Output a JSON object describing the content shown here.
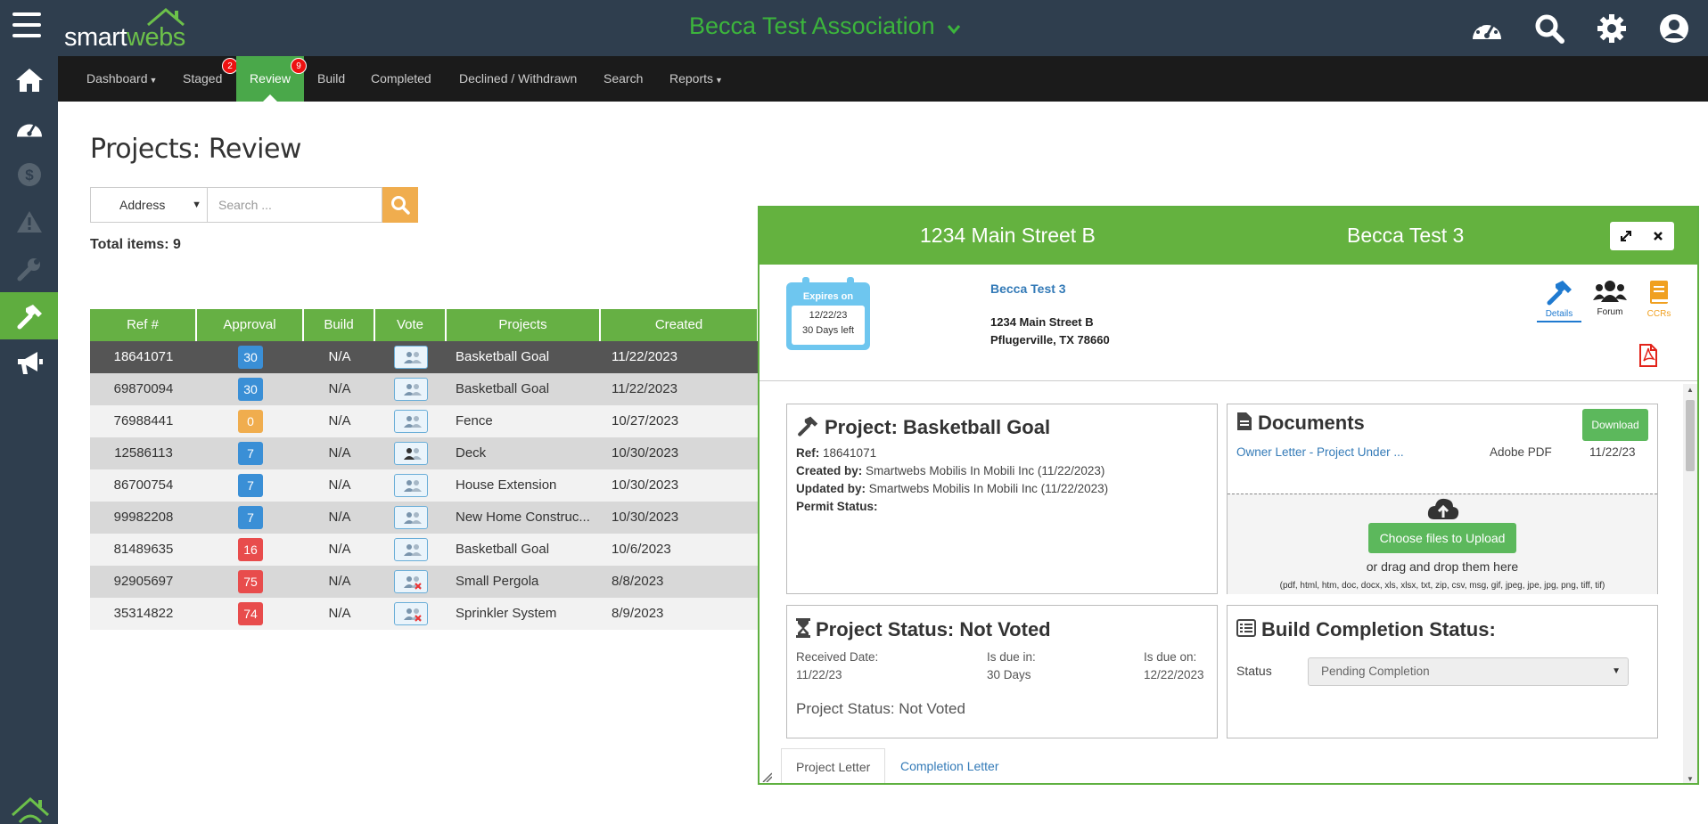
{
  "app": {
    "logo_text_white": "smart",
    "logo_text_green": "webs",
    "association": "Becca Test Association"
  },
  "top_icons": [
    "dashboard-gauge-icon",
    "search-icon",
    "gear-icon",
    "user-circle-icon"
  ],
  "sidebar": {
    "items": [
      {
        "name": "home-icon",
        "active": false
      },
      {
        "name": "dashboard-gauge-icon",
        "active": false
      },
      {
        "name": "dollar-icon",
        "active": false
      },
      {
        "name": "warning-icon",
        "active": false
      },
      {
        "name": "wrench-icon",
        "active": false
      },
      {
        "name": "hammer-icon",
        "active": true
      },
      {
        "name": "megaphone-icon",
        "active": false
      }
    ]
  },
  "nav": {
    "dashboard": "Dashboard",
    "staged": "Staged",
    "staged_count": "2",
    "review": "Review",
    "review_count": "9",
    "build": "Build",
    "completed": "Completed",
    "declined": "Declined / Withdrawn",
    "search": "Search",
    "reports": "Reports"
  },
  "page": {
    "title": "Projects: Review",
    "filter_value": "Address",
    "search_placeholder": "Search ...",
    "total_label": "Total items: 9"
  },
  "table": {
    "headers": {
      "ref": "Ref #",
      "approval": "Approval",
      "build": "Build",
      "vote": "Vote",
      "projects": "Projects",
      "created": "Created"
    },
    "rows": [
      {
        "ref": "18641071",
        "approval": "30",
        "build": "N/A",
        "project": "Basketball Goal",
        "created": "11/22/2023"
      },
      {
        "ref": "69870094",
        "approval": "30",
        "build": "N/A",
        "project": "Basketball Goal",
        "created": "11/22/2023"
      },
      {
        "ref": "76988441",
        "approval": "0",
        "build": "N/A",
        "project": "Fence",
        "created": "10/27/2023"
      },
      {
        "ref": "12586113",
        "approval": "7",
        "build": "N/A",
        "project": "Deck",
        "created": "10/30/2023"
      },
      {
        "ref": "86700754",
        "approval": "7",
        "build": "N/A",
        "project": "House Extension",
        "created": "10/30/2023"
      },
      {
        "ref": "99982208",
        "approval": "7",
        "build": "N/A",
        "project": "New Home Construc...",
        "created": "10/30/2023"
      },
      {
        "ref": "81489635",
        "approval": "16",
        "build": "N/A",
        "project": "Basketball Goal",
        "created": "10/6/2023"
      },
      {
        "ref": "92905697",
        "approval": "75",
        "build": "N/A",
        "project": "Small Pergola",
        "created": "8/8/2023"
      },
      {
        "ref": "35314822",
        "approval": "74",
        "build": "N/A",
        "project": "Sprinkler System",
        "created": "8/9/2023"
      }
    ],
    "badge_colors": {
      "blue": "#3a8fd6",
      "orange": "#f0ad4e",
      "red": "#e84c4c"
    }
  },
  "panel": {
    "address": "1234 Main Street B",
    "association": "Becca Test 3",
    "expires_label": "Expires on",
    "expires_date": "12/22/23",
    "days_left": "30 Days left",
    "owner": "Becca Test 3",
    "addr_line1": "1234 Main Street B",
    "addr_line2": "Pflugerville, TX 78660",
    "tabs": {
      "details": "Details",
      "forum": "Forum",
      "ccrs": "CCRs"
    },
    "project": {
      "title": "Project: Basketball Goal",
      "ref_label": "Ref:",
      "ref": "18641071",
      "created_label": "Created by:",
      "created": "Smartwebs Mobilis In Mobili Inc (11/22/2023)",
      "updated_label": "Updated by:",
      "updated": "Smartwebs Mobilis In Mobili Inc (11/22/2023)",
      "permit_label": "Permit Status:"
    },
    "documents": {
      "title": "Documents",
      "download": "Download",
      "doc_name": "Owner Letter - Project Under ...",
      "doc_type": "Adobe PDF",
      "doc_date": "11/22/23",
      "upload_btn": "Choose files to Upload",
      "upload_or": "or drag and drop them here",
      "upload_types": "(pdf, html, htm, doc, docx, xls, xlsx, txt, zip, csv, msg, gif, jpeg, jpe, jpg, png, tiff, tif)"
    },
    "status": {
      "title": "Project Status: Not Voted",
      "received_label": "Received Date:",
      "received": "11/22/23",
      "due_in_label": "Is due in:",
      "due_in": "30 Days",
      "due_on_label": "Is due on:",
      "due_on": "12/22/2023",
      "status_line": "Project Status: Not Voted"
    },
    "build": {
      "title": "Build Completion Status:",
      "status_label": "Status",
      "status_value": "Pending Completion"
    },
    "bottom_tabs": {
      "project_letter": "Project Letter",
      "completion_letter": "Completion Letter"
    }
  }
}
